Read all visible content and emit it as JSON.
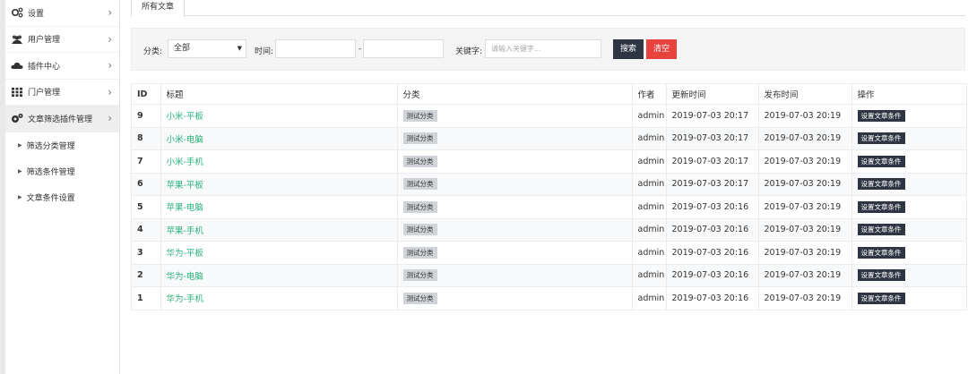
{
  "sidebar": {
    "items": [
      {
        "label": "设置",
        "icon": "gears-icon",
        "chevron": "›"
      },
      {
        "label": "用户管理",
        "icon": "users-icon",
        "chevron": "›"
      },
      {
        "label": "插件中心",
        "icon": "cloud-icon",
        "chevron": "›"
      },
      {
        "label": "门户管理",
        "icon": "grid-icon",
        "chevron": "›"
      },
      {
        "label": "文章筛选插件管理",
        "icon": "cogs-icon",
        "chevron": "›"
      }
    ],
    "subitems": [
      {
        "label": "筛选分类管理"
      },
      {
        "label": "筛选条件管理"
      },
      {
        "label": "文章条件设置"
      }
    ]
  },
  "tabs": [
    {
      "label": "所有文章"
    }
  ],
  "filter": {
    "category_label": "分类:",
    "category_value": "全部",
    "time_label": "时间:",
    "time_separator": "-",
    "keyword_label": "关键字:",
    "keyword_placeholder": "请输入关键字...",
    "search_button": "搜索",
    "clear_button": "清空"
  },
  "table": {
    "headers": [
      "ID",
      "标题",
      "分类",
      "作者",
      "更新时间",
      "发布时间",
      "操作"
    ],
    "rows": [
      {
        "id": "9",
        "title": "小米-平板",
        "category": "测试分类",
        "author": "admin",
        "updated": "2019-07-03 20:17",
        "published": "2019-07-03 20:19",
        "action": "设置文章条件"
      },
      {
        "id": "8",
        "title": "小米-电脑",
        "category": "测试分类",
        "author": "admin",
        "updated": "2019-07-03 20:17",
        "published": "2019-07-03 20:19",
        "action": "设置文章条件"
      },
      {
        "id": "7",
        "title": "小米-手机",
        "category": "测试分类",
        "author": "admin",
        "updated": "2019-07-03 20:17",
        "published": "2019-07-03 20:19",
        "action": "设置文章条件"
      },
      {
        "id": "6",
        "title": "苹果-平板",
        "category": "测试分类",
        "author": "admin",
        "updated": "2019-07-03 20:17",
        "published": "2019-07-03 20:19",
        "action": "设置文章条件"
      },
      {
        "id": "5",
        "title": "苹果-电脑",
        "category": "测试分类",
        "author": "admin",
        "updated": "2019-07-03 20:16",
        "published": "2019-07-03 20:19",
        "action": "设置文章条件"
      },
      {
        "id": "4",
        "title": "苹果-手机",
        "category": "测试分类",
        "author": "admin",
        "updated": "2019-07-03 20:16",
        "published": "2019-07-03 20:19",
        "action": "设置文章条件"
      },
      {
        "id": "3",
        "title": "华为-平板",
        "category": "测试分类",
        "author": "admin",
        "updated": "2019-07-03 20:16",
        "published": "2019-07-03 20:19",
        "action": "设置文章条件"
      },
      {
        "id": "2",
        "title": "华为-电脑",
        "category": "测试分类",
        "author": "admin",
        "updated": "2019-07-03 20:16",
        "published": "2019-07-03 20:19",
        "action": "设置文章条件"
      },
      {
        "id": "1",
        "title": "华为-手机",
        "category": "测试分类",
        "author": "admin",
        "updated": "2019-07-03 20:16",
        "published": "2019-07-03 20:19",
        "action": "设置文章条件"
      }
    ]
  },
  "colors": {
    "title_link": "#2bb37c",
    "search_button": "#2f3542",
    "clear_button": "#e8423c",
    "badge": "#d0d4d9",
    "sidebar_active": "#eeeeee"
  }
}
